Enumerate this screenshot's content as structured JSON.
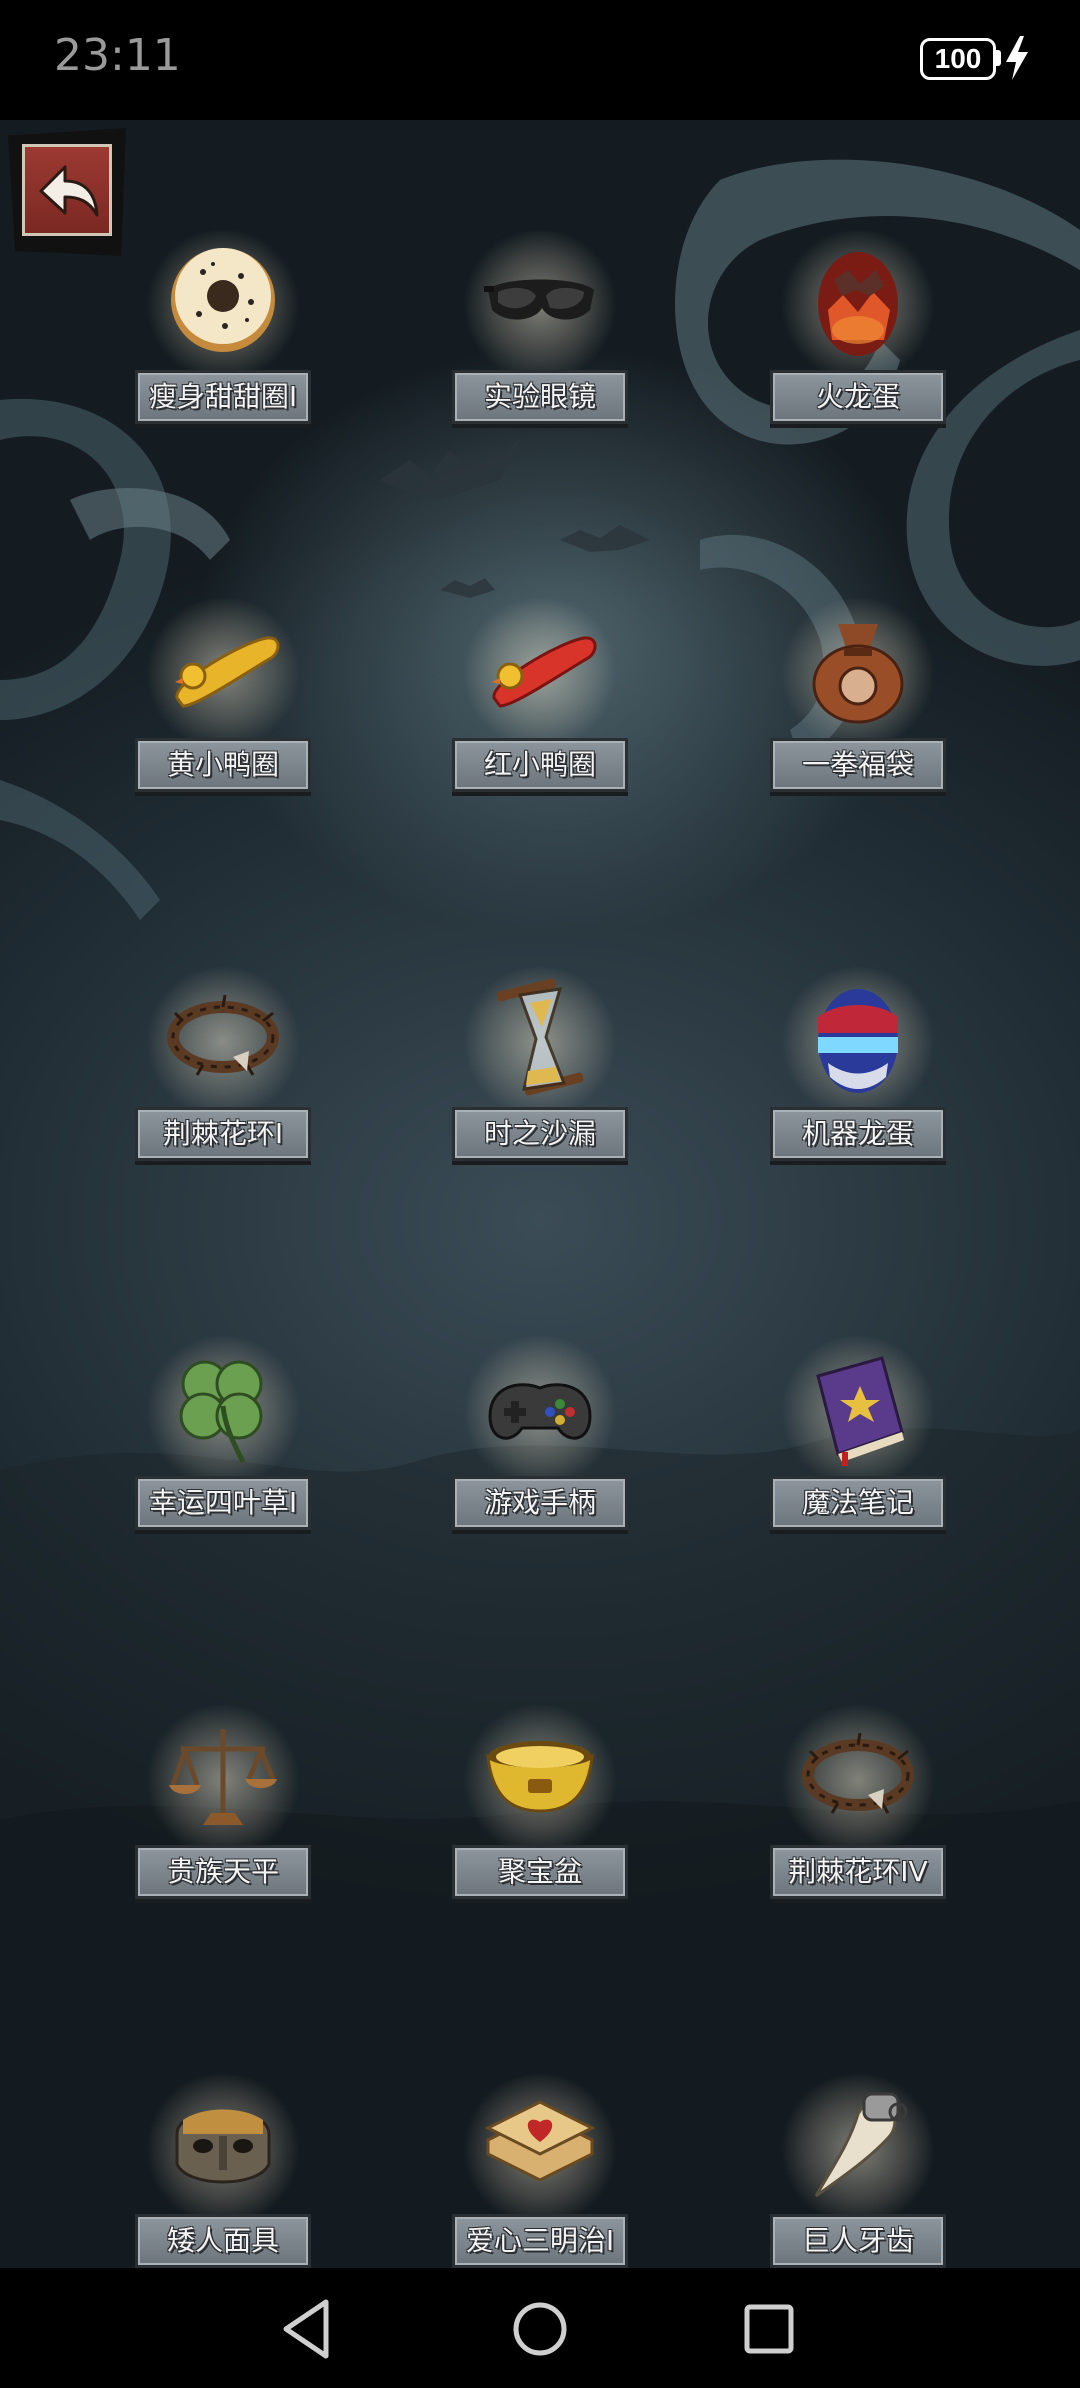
{
  "status_bar": {
    "time": "23:11",
    "battery": "100"
  },
  "back_button": {
    "icon": "return-arrow-icon"
  },
  "items": [
    {
      "label": "瘦身甜甜圈I",
      "icon": "donut-icon"
    },
    {
      "label": "实验眼镜",
      "icon": "goggles-icon"
    },
    {
      "label": "火龙蛋",
      "icon": "fire-dragon-egg-icon"
    },
    {
      "label": "黄小鸭圈",
      "icon": "yellow-duck-ring-icon"
    },
    {
      "label": "红小鸭圈",
      "icon": "red-duck-ring-icon"
    },
    {
      "label": "一拳福袋",
      "icon": "fist-lucky-bag-icon"
    },
    {
      "label": "荆棘花环I",
      "icon": "thorn-wreath-icon"
    },
    {
      "label": "时之沙漏",
      "icon": "hourglass-icon"
    },
    {
      "label": "机器龙蛋",
      "icon": "robot-dragon-egg-icon"
    },
    {
      "label": "幸运四叶草I",
      "icon": "four-leaf-clover-icon"
    },
    {
      "label": "游戏手柄",
      "icon": "gamepad-icon"
    },
    {
      "label": "魔法笔记",
      "icon": "magic-book-icon"
    },
    {
      "label": "贵族天平",
      "icon": "balance-scale-icon"
    },
    {
      "label": "聚宝盆",
      "icon": "treasure-bowl-icon"
    },
    {
      "label": "荆棘花环IV",
      "icon": "thorn-wreath-icon"
    },
    {
      "label": "矮人面具",
      "icon": "dwarf-mask-icon"
    },
    {
      "label": "爱心三明治I",
      "icon": "heart-sandwich-icon"
    },
    {
      "label": "巨人牙齿",
      "icon": "giant-tooth-icon"
    }
  ],
  "nav_bar": {
    "back": "triangle-back-icon",
    "home": "circle-home-icon",
    "recents": "square-recents-icon"
  }
}
